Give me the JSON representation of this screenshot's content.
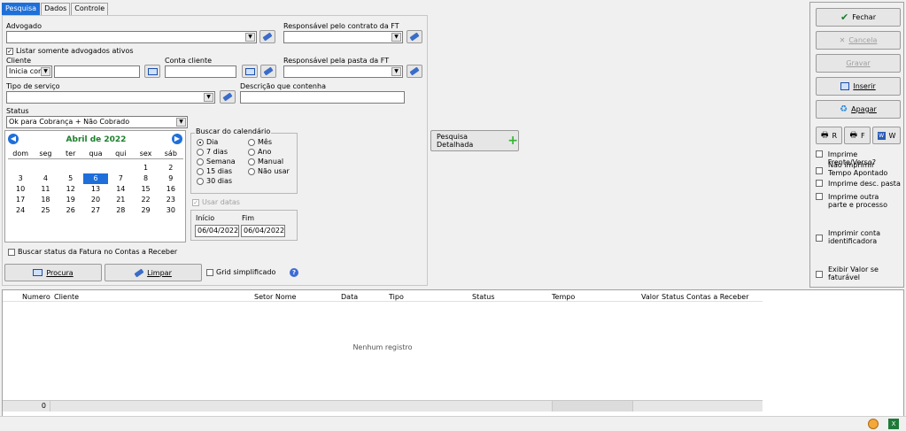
{
  "tabs": [
    "Pesquisa",
    "Dados",
    "Controle"
  ],
  "form": {
    "advogado_label": "Advogado",
    "responsavel_contrato_label": "Responsável pelo contrato da FT",
    "listar_ativos_label": "Listar somente advogados ativos",
    "cliente_label": "Cliente",
    "cliente_mode": "Inicia com",
    "conta_cliente_label": "Conta cliente",
    "responsavel_pasta_label": "Responsável pela pasta da FT",
    "tipo_servico_label": "Tipo de serviço",
    "descricao_label": "Descrição que contenha",
    "status_label": "Status",
    "status_value": "Ok para Cobrança + Não Cobrado",
    "buscar_status_label": "Buscar status da Fatura no Contas a Receber",
    "procura_label": "Procura",
    "limpar_label": "Limpar",
    "grid_simplificado_label": "Grid simplificado"
  },
  "calendar": {
    "month_title": "Abril de 2022",
    "weekdays": [
      "dom",
      "seg",
      "ter",
      "qua",
      "qui",
      "sex",
      "sáb"
    ],
    "weeks": [
      [
        "",
        "",
        "",
        "",
        "",
        "1",
        "2"
      ],
      [
        "3",
        "4",
        "5",
        "6",
        "7",
        "8",
        "9"
      ],
      [
        "10",
        "11",
        "12",
        "13",
        "14",
        "15",
        "16"
      ],
      [
        "17",
        "18",
        "19",
        "20",
        "21",
        "22",
        "23"
      ],
      [
        "24",
        "25",
        "26",
        "27",
        "28",
        "29",
        "30"
      ]
    ],
    "selected": "6"
  },
  "buscar": {
    "title": "Buscar do calendário",
    "options_left": [
      "Dia",
      "7 dias",
      "Semana",
      "15 dias",
      "30 dias"
    ],
    "options_right": [
      "Mês",
      "Ano",
      "Manual",
      "Não usar"
    ],
    "selected": "Dia",
    "usar_datas_label": "Usar datas",
    "inicio_label": "Início",
    "fim_label": "Fim",
    "inicio_value": "06/04/2022",
    "fim_value": "06/04/2022"
  },
  "pesquisa_detalhada_label": "Pesquisa Detalhada",
  "actions": {
    "fechar": "Fechar",
    "cancela": "Cancela",
    "gravar": "Gravar",
    "inserir": "Inserir",
    "apagar": "Apagar",
    "r": "R",
    "f": "F",
    "w": "W"
  },
  "options": {
    "frente_verso": "Imprime Frente/Verso?",
    "nao_imprimir_tempo": "Não imprimir Tempo Apontado",
    "desc_pasta": "Imprime desc. pasta",
    "outra_parte": "Imprime outra parte e processo",
    "conta_identificadora": "Imprimir conta identificadora",
    "valor_faturavel": "Exibir Valor se faturável"
  },
  "grid": {
    "columns": [
      "Numero",
      "Cliente",
      "Setor Nome",
      "Data",
      "Tipo",
      "Status",
      "Tempo",
      "Valor",
      "Status Contas a Receber"
    ],
    "empty_text": "Nenhum registro",
    "footer_count": "0"
  },
  "colors": {
    "accent": "#1e6fd9",
    "calendar_title": "#1a7f2a"
  }
}
